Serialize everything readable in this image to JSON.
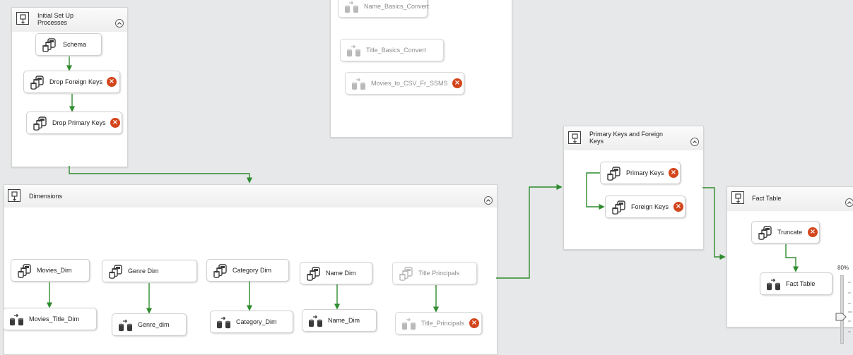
{
  "containers": {
    "initial_setup": {
      "title": "Initial Set Up Processes"
    },
    "dimensions": {
      "title": "Dimensions"
    },
    "pk_fk": {
      "title": "Primary Keys and Foreign Keys"
    },
    "fact_table": {
      "title": "Fact Table"
    }
  },
  "tasks": {
    "schema": "Schema",
    "drop_foreign_keys": "Drop Foreign Keys",
    "drop_primary_keys": "Drop Primary Keys",
    "name_basics_convert": "Name_Basics_Convert",
    "title_basics_convert": "Title_Basics_Convert",
    "movies_to_csv": "Movies_to_CSV_Fr_SSMS",
    "movies_dim": "Movies_Dim",
    "movies_title_dim": "Movies_Title_Dim",
    "genre_dim": "Genre Dim",
    "genre_dim2": "Genre_dim",
    "category_dim": "Category Dim",
    "category_dim2": "Category_Dim",
    "name_dim": "Name Dim",
    "name_dim2": "Name_Dim",
    "title_principals": "Title Principals",
    "title_principals2": "Title_Principals",
    "primary_keys": "Primary Keys",
    "foreign_keys": "Foreign Keys",
    "truncate": "Truncate",
    "fact_table": "Fact Table"
  },
  "zoom": {
    "label": "80%"
  },
  "icons": {
    "sql_task": "sql-task-icon",
    "dataflow_task": "dataflow-task-icon",
    "error_badge": "error-icon",
    "container": "sequence-container-icon",
    "collapse": "collapse-chevron-icon"
  },
  "colors": {
    "connector": "#2e8b2e",
    "error": "#d3451b",
    "canvas": "#e7e8e9"
  }
}
